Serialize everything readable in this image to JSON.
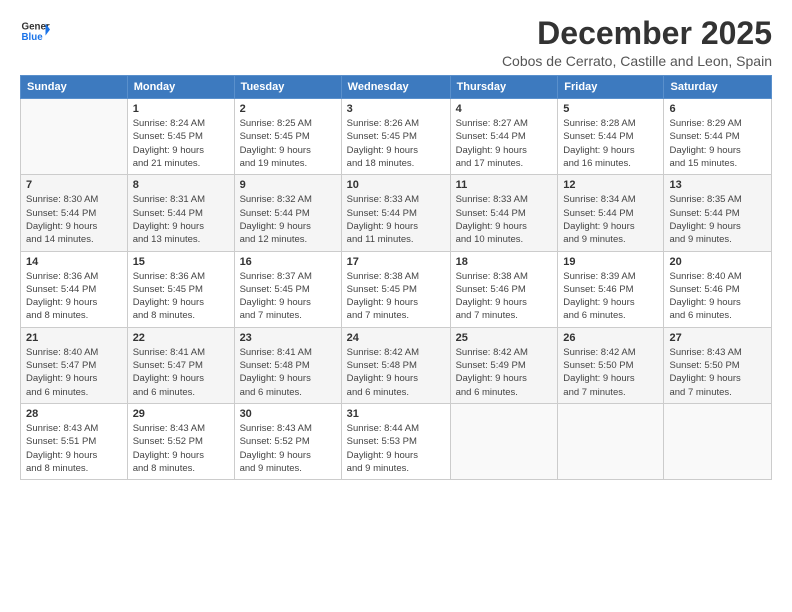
{
  "logo": {
    "line1": "General",
    "line2": "Blue"
  },
  "title": "December 2025",
  "subtitle": "Cobos de Cerrato, Castille and Leon, Spain",
  "calendar": {
    "headers": [
      "Sunday",
      "Monday",
      "Tuesday",
      "Wednesday",
      "Thursday",
      "Friday",
      "Saturday"
    ],
    "weeks": [
      [
        {
          "day": "",
          "info": ""
        },
        {
          "day": "1",
          "info": "Sunrise: 8:24 AM\nSunset: 5:45 PM\nDaylight: 9 hours\nand 21 minutes."
        },
        {
          "day": "2",
          "info": "Sunrise: 8:25 AM\nSunset: 5:45 PM\nDaylight: 9 hours\nand 19 minutes."
        },
        {
          "day": "3",
          "info": "Sunrise: 8:26 AM\nSunset: 5:45 PM\nDaylight: 9 hours\nand 18 minutes."
        },
        {
          "day": "4",
          "info": "Sunrise: 8:27 AM\nSunset: 5:44 PM\nDaylight: 9 hours\nand 17 minutes."
        },
        {
          "day": "5",
          "info": "Sunrise: 8:28 AM\nSunset: 5:44 PM\nDaylight: 9 hours\nand 16 minutes."
        },
        {
          "day": "6",
          "info": "Sunrise: 8:29 AM\nSunset: 5:44 PM\nDaylight: 9 hours\nand 15 minutes."
        }
      ],
      [
        {
          "day": "7",
          "info": "Sunrise: 8:30 AM\nSunset: 5:44 PM\nDaylight: 9 hours\nand 14 minutes."
        },
        {
          "day": "8",
          "info": "Sunrise: 8:31 AM\nSunset: 5:44 PM\nDaylight: 9 hours\nand 13 minutes."
        },
        {
          "day": "9",
          "info": "Sunrise: 8:32 AM\nSunset: 5:44 PM\nDaylight: 9 hours\nand 12 minutes."
        },
        {
          "day": "10",
          "info": "Sunrise: 8:33 AM\nSunset: 5:44 PM\nDaylight: 9 hours\nand 11 minutes."
        },
        {
          "day": "11",
          "info": "Sunrise: 8:33 AM\nSunset: 5:44 PM\nDaylight: 9 hours\nand 10 minutes."
        },
        {
          "day": "12",
          "info": "Sunrise: 8:34 AM\nSunset: 5:44 PM\nDaylight: 9 hours\nand 9 minutes."
        },
        {
          "day": "13",
          "info": "Sunrise: 8:35 AM\nSunset: 5:44 PM\nDaylight: 9 hours\nand 9 minutes."
        }
      ],
      [
        {
          "day": "14",
          "info": "Sunrise: 8:36 AM\nSunset: 5:44 PM\nDaylight: 9 hours\nand 8 minutes."
        },
        {
          "day": "15",
          "info": "Sunrise: 8:36 AM\nSunset: 5:45 PM\nDaylight: 9 hours\nand 8 minutes."
        },
        {
          "day": "16",
          "info": "Sunrise: 8:37 AM\nSunset: 5:45 PM\nDaylight: 9 hours\nand 7 minutes."
        },
        {
          "day": "17",
          "info": "Sunrise: 8:38 AM\nSunset: 5:45 PM\nDaylight: 9 hours\nand 7 minutes."
        },
        {
          "day": "18",
          "info": "Sunrise: 8:38 AM\nSunset: 5:46 PM\nDaylight: 9 hours\nand 7 minutes."
        },
        {
          "day": "19",
          "info": "Sunrise: 8:39 AM\nSunset: 5:46 PM\nDaylight: 9 hours\nand 6 minutes."
        },
        {
          "day": "20",
          "info": "Sunrise: 8:40 AM\nSunset: 5:46 PM\nDaylight: 9 hours\nand 6 minutes."
        }
      ],
      [
        {
          "day": "21",
          "info": "Sunrise: 8:40 AM\nSunset: 5:47 PM\nDaylight: 9 hours\nand 6 minutes."
        },
        {
          "day": "22",
          "info": "Sunrise: 8:41 AM\nSunset: 5:47 PM\nDaylight: 9 hours\nand 6 minutes."
        },
        {
          "day": "23",
          "info": "Sunrise: 8:41 AM\nSunset: 5:48 PM\nDaylight: 9 hours\nand 6 minutes."
        },
        {
          "day": "24",
          "info": "Sunrise: 8:42 AM\nSunset: 5:48 PM\nDaylight: 9 hours\nand 6 minutes."
        },
        {
          "day": "25",
          "info": "Sunrise: 8:42 AM\nSunset: 5:49 PM\nDaylight: 9 hours\nand 6 minutes."
        },
        {
          "day": "26",
          "info": "Sunrise: 8:42 AM\nSunset: 5:50 PM\nDaylight: 9 hours\nand 7 minutes."
        },
        {
          "day": "27",
          "info": "Sunrise: 8:43 AM\nSunset: 5:50 PM\nDaylight: 9 hours\nand 7 minutes."
        }
      ],
      [
        {
          "day": "28",
          "info": "Sunrise: 8:43 AM\nSunset: 5:51 PM\nDaylight: 9 hours\nand 8 minutes."
        },
        {
          "day": "29",
          "info": "Sunrise: 8:43 AM\nSunset: 5:52 PM\nDaylight: 9 hours\nand 8 minutes."
        },
        {
          "day": "30",
          "info": "Sunrise: 8:43 AM\nSunset: 5:52 PM\nDaylight: 9 hours\nand 9 minutes."
        },
        {
          "day": "31",
          "info": "Sunrise: 8:44 AM\nSunset: 5:53 PM\nDaylight: 9 hours\nand 9 minutes."
        },
        {
          "day": "",
          "info": ""
        },
        {
          "day": "",
          "info": ""
        },
        {
          "day": "",
          "info": ""
        }
      ]
    ]
  }
}
